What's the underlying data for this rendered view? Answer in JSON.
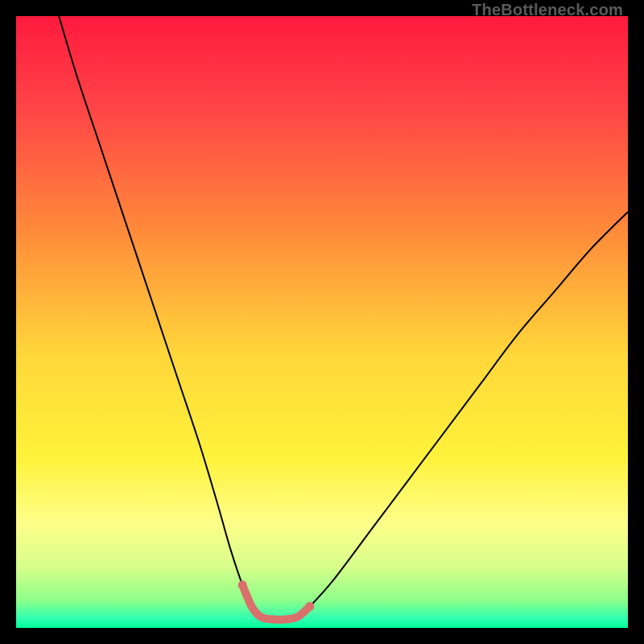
{
  "watermark": "TheBottleneck.com",
  "chart_data": {
    "type": "line",
    "title": "",
    "xlabel": "",
    "ylabel": "",
    "xlim": [
      0,
      100
    ],
    "ylim": [
      0,
      100
    ],
    "grid": false,
    "legend": false,
    "background": {
      "type": "vertical-gradient",
      "stops": [
        {
          "pos": 0.0,
          "color": "#ff1a3e"
        },
        {
          "pos": 0.15,
          "color": "#ff4447"
        },
        {
          "pos": 0.35,
          "color": "#ff8a3a"
        },
        {
          "pos": 0.55,
          "color": "#ffd63a"
        },
        {
          "pos": 0.72,
          "color": "#fff23a"
        },
        {
          "pos": 0.83,
          "color": "#fdff8a"
        },
        {
          "pos": 0.9,
          "color": "#d7ff8a"
        },
        {
          "pos": 0.955,
          "color": "#8dff8a"
        },
        {
          "pos": 0.985,
          "color": "#2dffb0"
        },
        {
          "pos": 1.0,
          "color": "#00ff9c"
        }
      ]
    },
    "series": [
      {
        "name": "bottleneck-curve",
        "stroke": "#000000",
        "stroke_width": 2,
        "x": [
          7,
          10,
          14,
          18,
          22,
          26,
          30,
          33,
          35,
          37,
          38.5,
          40,
          42,
          44,
          46,
          48,
          52,
          58,
          64,
          70,
          76,
          82,
          88,
          94,
          100
        ],
        "values": [
          100,
          90,
          78,
          66,
          54,
          42,
          30,
          20,
          13,
          7,
          3.5,
          1.8,
          1.4,
          1.4,
          1.8,
          3.5,
          8,
          16,
          24,
          32,
          40,
          48,
          55,
          62,
          68
        ]
      },
      {
        "name": "optimal-range-marker",
        "stroke": "#d9706c",
        "stroke_width": 10,
        "linecap": "round",
        "x": [
          37,
          38.5,
          40,
          42,
          44,
          46,
          48
        ],
        "values": [
          7,
          3.5,
          1.8,
          1.4,
          1.4,
          1.8,
          3.5
        ]
      }
    ],
    "optimal_range_pct": {
      "start": 37,
      "end": 48
    }
  }
}
